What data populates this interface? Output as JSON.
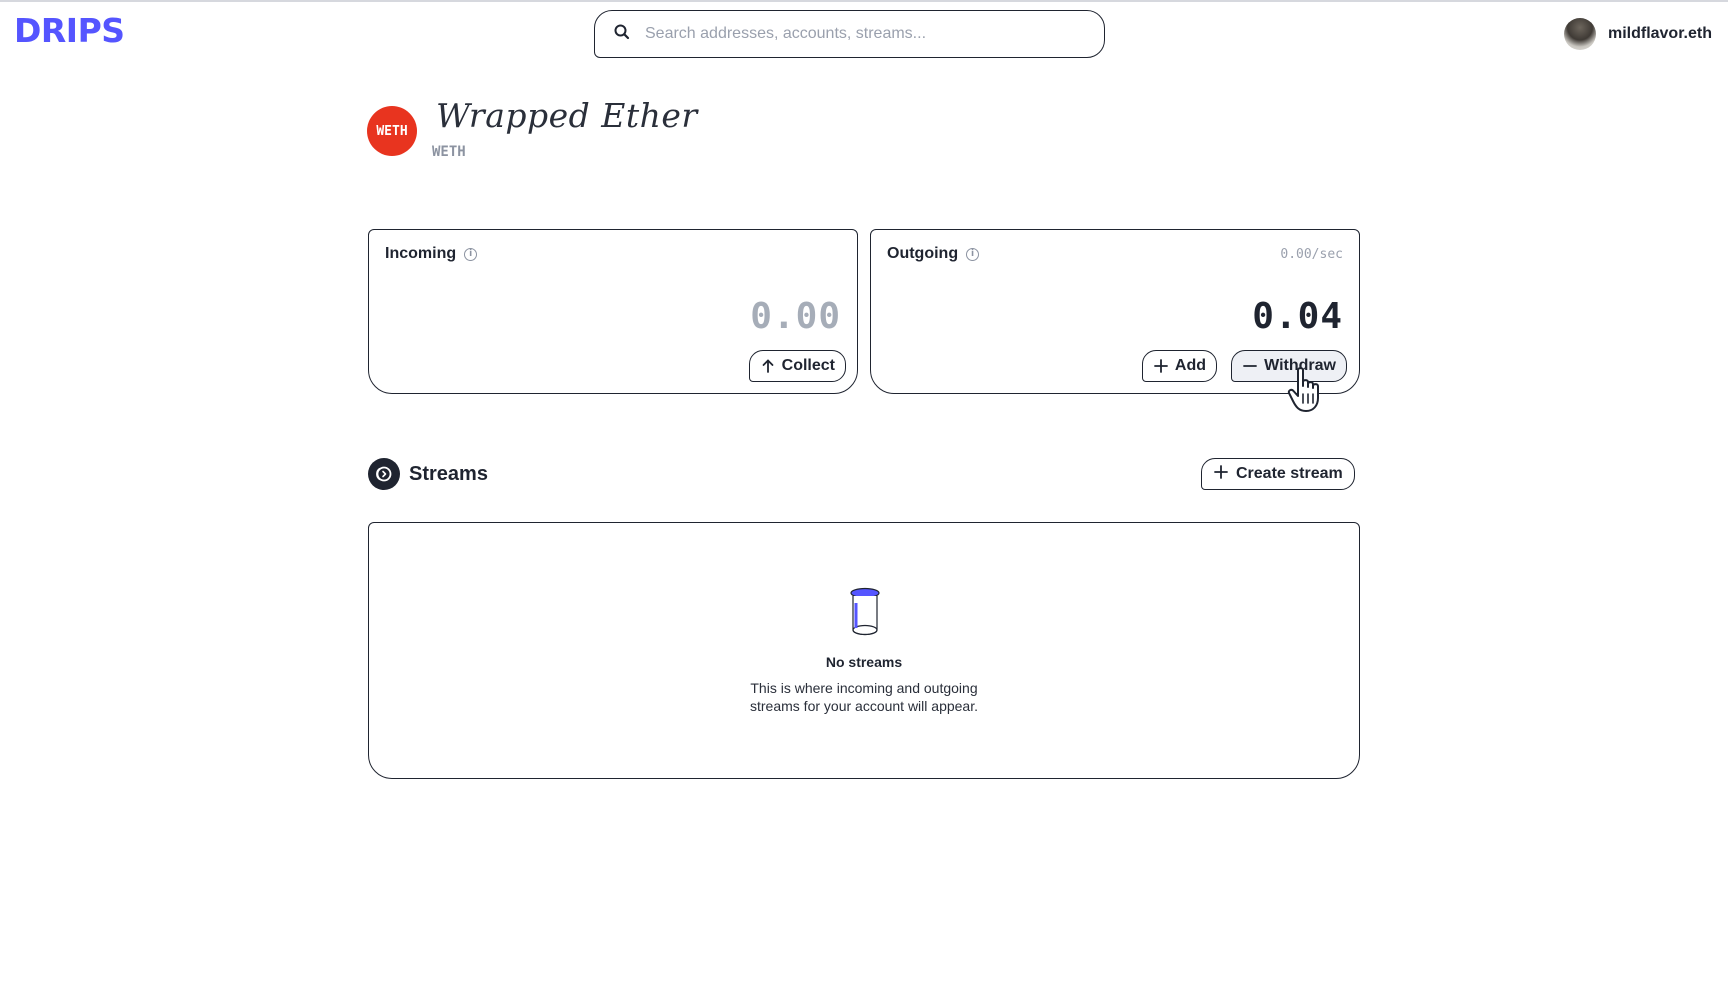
{
  "header": {
    "logo": "DRIPS",
    "search_placeholder": "Search addresses, accounts, streams...",
    "user_name": "mildflavor.eth"
  },
  "token": {
    "badge": "WETH",
    "name": "Wrapped Ether",
    "symbol": "WETH"
  },
  "incoming": {
    "title": "Incoming",
    "amount": "0.00",
    "collect_label": "Collect"
  },
  "outgoing": {
    "title": "Outgoing",
    "rate": "0.00/sec",
    "amount": "0.04",
    "add_label": "Add",
    "withdraw_label": "Withdraw"
  },
  "streams": {
    "title": "Streams",
    "create_label": "Create stream",
    "empty_title": "No streams",
    "empty_description": "This is where incoming and outgoing streams for your account will appear."
  },
  "colors": {
    "brand": "#5555ff",
    "token_badge": "#e8341f",
    "text": "#1f2430",
    "muted": "#a6adb8"
  }
}
